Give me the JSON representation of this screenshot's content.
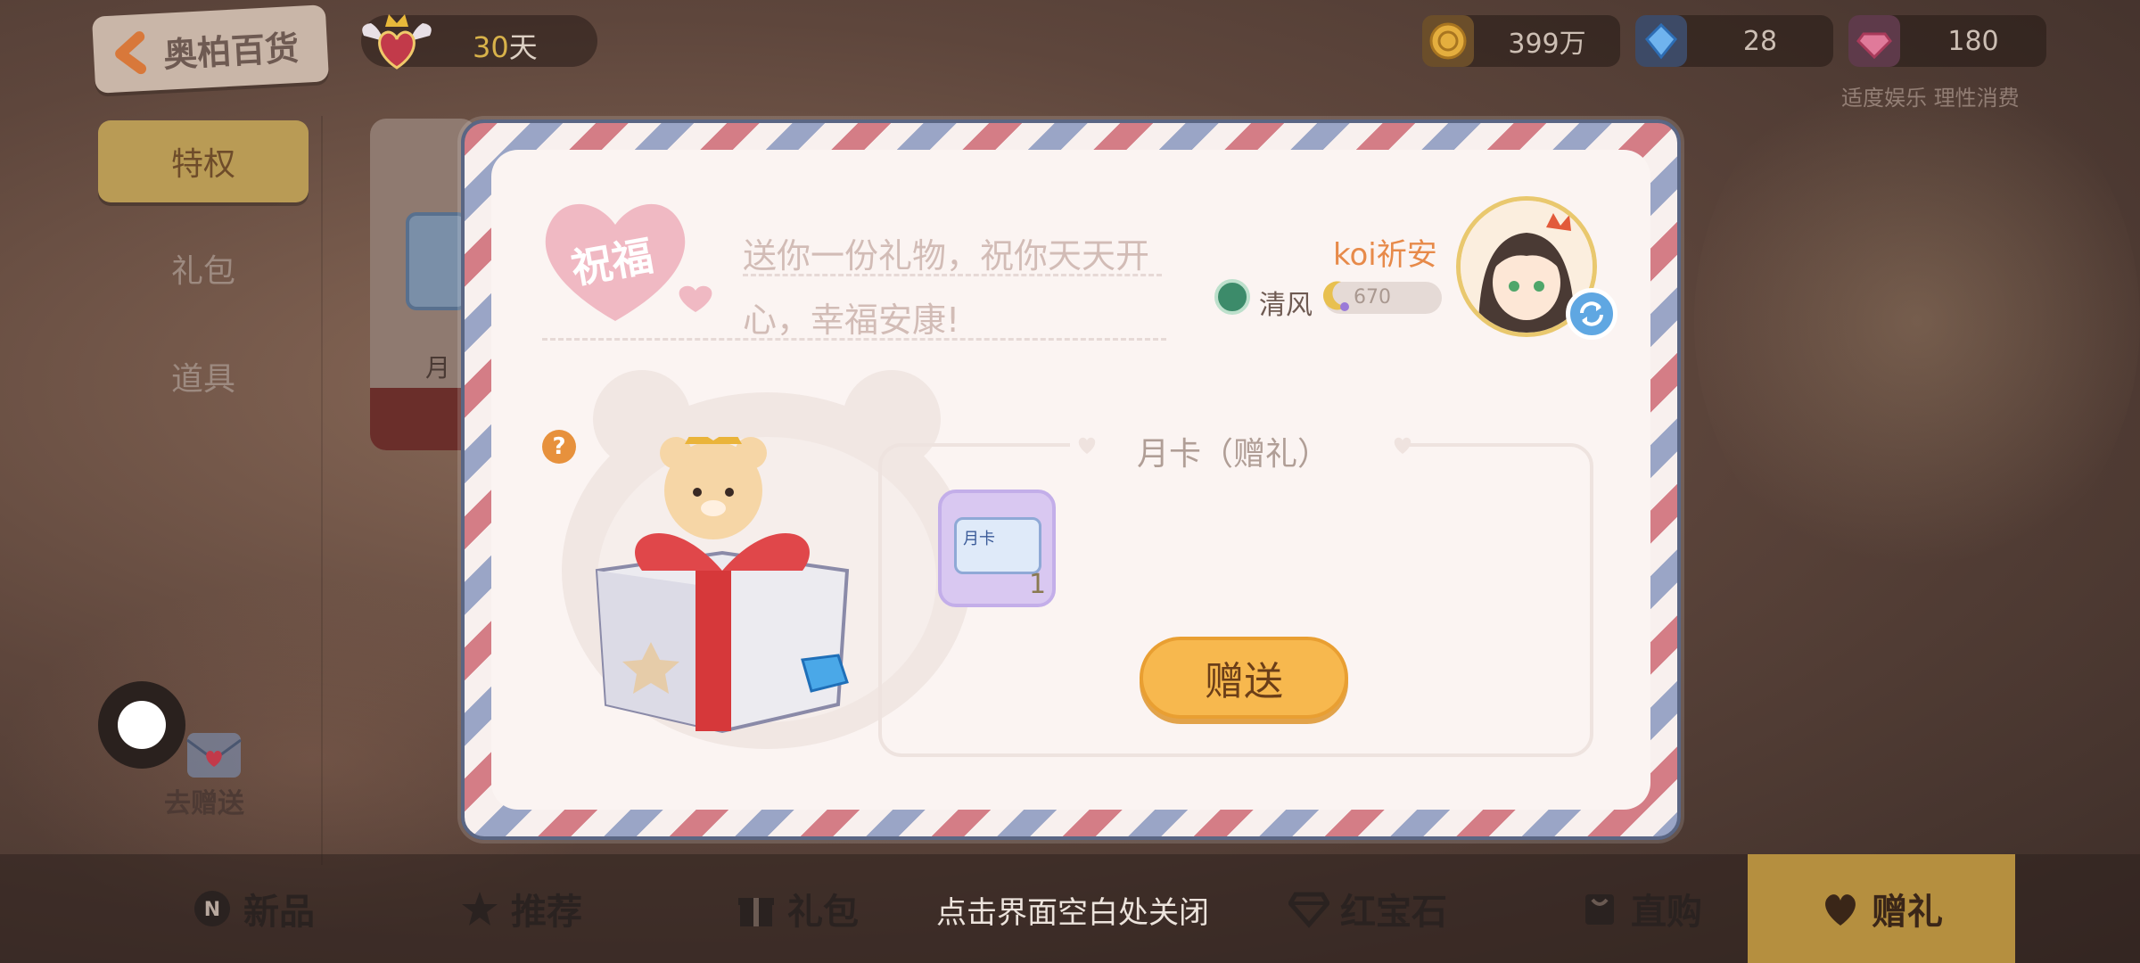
{
  "header": {
    "back_title": "奥柏百货",
    "vip_days_number": "30",
    "vip_days_unit": "天",
    "currencies": [
      {
        "name": "gold",
        "value": "399万",
        "icon": "gold-coin-icon",
        "color": "#d8a53a"
      },
      {
        "name": "crystal",
        "value": "28",
        "icon": "crystal-icon",
        "color": "#4f92d8"
      },
      {
        "name": "gem",
        "value": "180",
        "icon": "pink-gem-icon",
        "color": "#d86a8c"
      }
    ],
    "note": "适度娱乐  理性消费"
  },
  "sidebar": {
    "tabs": [
      {
        "label": "特权",
        "active": true
      },
      {
        "label": "礼包",
        "active": false
      },
      {
        "label": "道具",
        "active": false
      }
    ],
    "card_label": "月"
  },
  "floating": {
    "go_gift_label": "去赠送"
  },
  "bottom_nav": {
    "items": [
      {
        "label": "新品",
        "icon": "new-badge-icon"
      },
      {
        "label": "推荐",
        "icon": "star-icon"
      },
      {
        "label": "礼包",
        "icon": "gift-icon"
      },
      {
        "label": "红宝石",
        "icon": "diamond-icon"
      },
      {
        "label": "直购",
        "icon": "shopping-bag-icon"
      },
      {
        "label": "赠礼",
        "icon": "heart-icon",
        "active": true
      }
    ],
    "close_hint": "点击界面空白处关闭"
  },
  "letter": {
    "blessing_label": "祝福",
    "message_line1": "送你一份礼物，祝你天天开",
    "message_line2": "心，幸福安康!",
    "sender": {
      "name": "koi祈安",
      "rank_name": "清风",
      "exp": "670"
    },
    "gift_panel": {
      "title": "月卡（赠礼）",
      "item": {
        "name": "月卡",
        "count": "1"
      },
      "send_label": "赠送"
    },
    "help_icon": "?"
  },
  "colors": {
    "stripe_red": "#d47d86",
    "stripe_blue": "#9aa5c6",
    "letter_bg": "#fbf4f2",
    "send_button": "#f7b84e",
    "active_nav": "#b58f3f"
  }
}
